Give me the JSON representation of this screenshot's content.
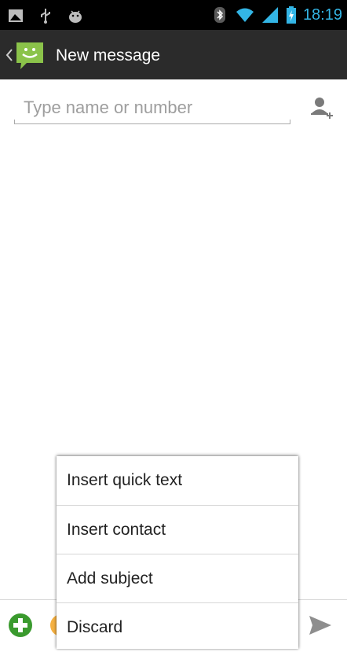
{
  "status_bar": {
    "time": "18:19",
    "icons": [
      "image-notification-icon",
      "usb-icon",
      "android-debug-icon",
      "bluetooth-icon",
      "wifi-icon",
      "signal-icon",
      "battery-charging-icon"
    ]
  },
  "action_bar": {
    "title": "New message",
    "icons": [
      "back-chevron-icon",
      "messaging-app-icon"
    ]
  },
  "recipient": {
    "placeholder": "Type name or number",
    "value": ""
  },
  "popup_menu": {
    "items": [
      {
        "label": "Insert quick text"
      },
      {
        "label": "Insert contact"
      },
      {
        "label": "Add subject"
      },
      {
        "label": "Discard"
      }
    ]
  },
  "compose_bar": {
    "icons": [
      "attach-plus-icon",
      "emoji-icon",
      "send-icon"
    ]
  },
  "colors": {
    "status_bar_bg": "#000000",
    "action_bar_bg": "#2b2b2b",
    "accent_blue": "#33b5e5",
    "app_icon_green": "#8bc34a",
    "attach_green": "#3a9a2e"
  }
}
